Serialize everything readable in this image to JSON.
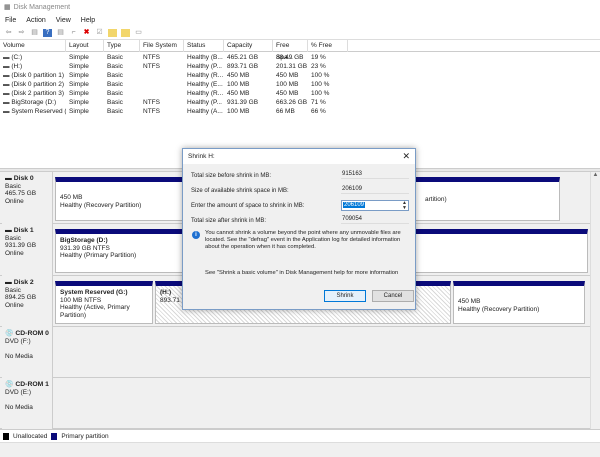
{
  "window": {
    "title": "Disk Management"
  },
  "menu": [
    "File",
    "Action",
    "View",
    "Help"
  ],
  "toolbar": [
    "back-icon",
    "forward-icon",
    "properties-icon",
    "help-icon",
    "list-icon",
    "connect-icon",
    "delete-icon",
    "check-icon",
    "folder-add-icon",
    "folder-icon",
    "view-icon"
  ],
  "volume_list": {
    "columns": [
      "Volume",
      "Layout",
      "Type",
      "File System",
      "Status",
      "Capacity",
      "Free Spa...",
      "% Free"
    ],
    "rows": [
      [
        "(C:)",
        "Simple",
        "Basic",
        "NTFS",
        "Healthy (B...",
        "465.21 GB",
        "88.49 GB",
        "19 %"
      ],
      [
        "(H:)",
        "Simple",
        "Basic",
        "NTFS",
        "Healthy (P...",
        "893.71 GB",
        "201.31 GB",
        "23 %"
      ],
      [
        "(Disk 0 partition 1)",
        "Simple",
        "Basic",
        "",
        "Healthy (R...",
        "450 MB",
        "450 MB",
        "100 %"
      ],
      [
        "(Disk 0 partition 2)",
        "Simple",
        "Basic",
        "",
        "Healthy (E...",
        "100 MB",
        "100 MB",
        "100 %"
      ],
      [
        "(Disk 2 partition 3)",
        "Simple",
        "Basic",
        "",
        "Healthy (R...",
        "450 MB",
        "450 MB",
        "100 %"
      ],
      [
        "BigStorage (D:)",
        "Simple",
        "Basic",
        "NTFS",
        "Healthy (P...",
        "931.39 GB",
        "663.26 GB",
        "71 %"
      ],
      [
        "System Reserved (...",
        "Simple",
        "Basic",
        "NTFS",
        "Healthy (A...",
        "100 MB",
        "66 MB",
        "66 %"
      ]
    ]
  },
  "disks": [
    {
      "name": "Disk 0",
      "type": "Basic",
      "size": "465.75 GB",
      "state": "Online",
      "partitions": [
        {
          "title": "",
          "line1": "450 MB",
          "line2": "Healthy (Recovery Partition)"
        }
      ]
    },
    {
      "name": "Disk 1",
      "type": "Basic",
      "size": "931.39 GB",
      "state": "Online",
      "partitions": [
        {
          "title": "BigStorage  (D:)",
          "line1": "931.39 GB NTFS",
          "line2": "Healthy (Primary Partition)"
        }
      ]
    },
    {
      "name": "Disk 2",
      "type": "Basic",
      "size": "894.25 GB",
      "state": "Online",
      "partitions": [
        {
          "title": "System Reserved  (G:)",
          "line1": "100 MB NTFS",
          "line2": "Healthy (Active, Primary Partition)"
        },
        {
          "title": "(H:)",
          "line1": "893.71 GB",
          "line2": ""
        },
        {
          "title": "",
          "line1": "450 MB",
          "line2": "Healthy (Recovery Partition)"
        }
      ]
    },
    {
      "name": "CD-ROM 0",
      "type": "DVD (F:)",
      "state": "No Media"
    },
    {
      "name": "CD-ROM 1",
      "type": "DVD (E:)",
      "state": "No Media"
    }
  ],
  "disk0_extra": "artition)",
  "legend": [
    {
      "label": "Unallocated",
      "color": "#000000"
    },
    {
      "label": "Primary partition",
      "color": "#0a0a7a"
    }
  ],
  "dialog": {
    "title": "Shrink H:",
    "fields": [
      {
        "label": "Total size before shrink in MB:",
        "value": "915163"
      },
      {
        "label": "Size of available shrink space in MB:",
        "value": "206109"
      },
      {
        "label": "Enter the amount of space to shrink in MB:",
        "value": "206109"
      },
      {
        "label": "Total size after shrink in MB:",
        "value": "709054"
      }
    ],
    "info": "You cannot shrink a volume beyond the point where any unmovable files are located. See the \"defrag\" event in the Application log for detailed information about the operation when it has completed.",
    "help": "See \"Shrink a basic volume\" in Disk Management help for more information",
    "shrink": "Shrink",
    "cancel": "Cancel"
  }
}
